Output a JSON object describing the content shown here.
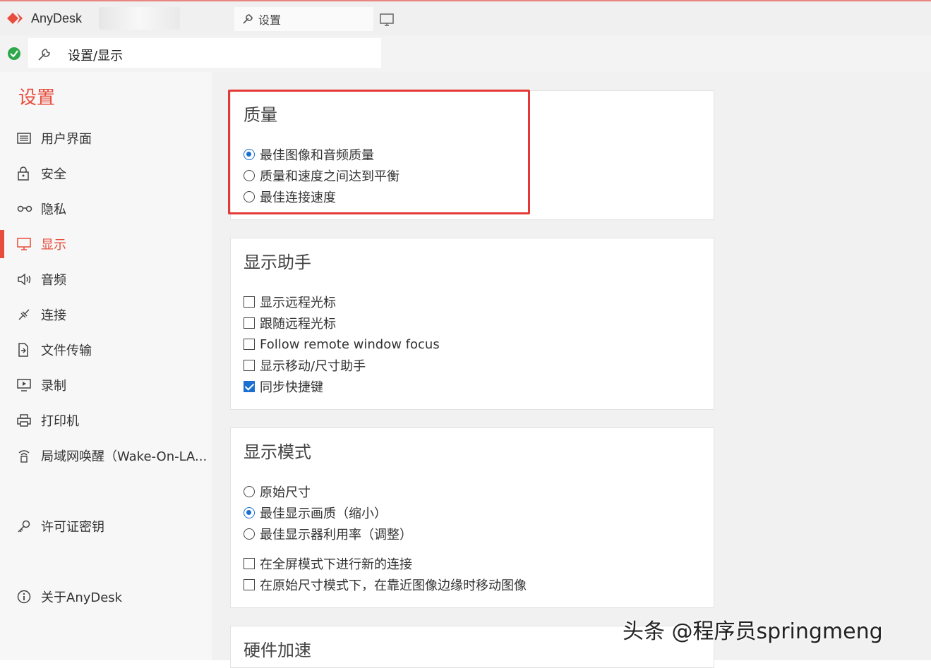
{
  "app": {
    "name": "AnyDesk",
    "brand_color": "#e74c3c",
    "accent_color": "#1a6fd0"
  },
  "tabs": {
    "settings_label": "设置"
  },
  "address": {
    "path": "设置/显示"
  },
  "sidebar": {
    "title": "设置",
    "items": [
      {
        "label": "用户界面",
        "icon": "window-icon",
        "active": false
      },
      {
        "label": "安全",
        "icon": "lock-icon",
        "active": false
      },
      {
        "label": "隐私",
        "icon": "glasses-icon",
        "active": false
      },
      {
        "label": "显示",
        "icon": "monitor-icon",
        "active": true
      },
      {
        "label": "音频",
        "icon": "speaker-icon",
        "active": false
      },
      {
        "label": "连接",
        "icon": "connection-icon",
        "active": false
      },
      {
        "label": "文件传输",
        "icon": "file-transfer-icon",
        "active": false
      },
      {
        "label": "录制",
        "icon": "recording-icon",
        "active": false
      },
      {
        "label": "打印机",
        "icon": "printer-icon",
        "active": false
      },
      {
        "label": "局域网唤醒（Wake-On-LA...",
        "icon": "wake-icon",
        "active": false
      },
      {
        "label": "许可证密钥",
        "icon": "key-icon",
        "active": false
      },
      {
        "label": "关于AnyDesk",
        "icon": "info-icon",
        "active": false
      }
    ]
  },
  "quality": {
    "title": "质量",
    "options": [
      {
        "label": "最佳图像和音频质量",
        "selected": true
      },
      {
        "label": "质量和速度之间达到平衡",
        "selected": false
      },
      {
        "label": "最佳连接速度",
        "selected": false
      }
    ]
  },
  "display_helper": {
    "title": "显示助手",
    "options": [
      {
        "label": "显示远程光标",
        "checked": false
      },
      {
        "label": "跟随远程光标",
        "checked": false
      },
      {
        "label": "Follow remote window focus",
        "checked": false
      },
      {
        "label": "显示移动/尺寸助手",
        "checked": false
      },
      {
        "label": "同步快捷键",
        "checked": true
      }
    ]
  },
  "display_mode": {
    "title": "显示模式",
    "radios": [
      {
        "label": "原始尺寸",
        "selected": false
      },
      {
        "label": "最佳显示画质（缩小）",
        "selected": true
      },
      {
        "label": "最佳显示器利用率（调整）",
        "selected": false
      }
    ],
    "checks": [
      {
        "label": "在全屏模式下进行新的连接",
        "checked": false
      },
      {
        "label": "在原始尺寸模式下，在靠近图像边缘时移动图像",
        "checked": false
      }
    ]
  },
  "hardware": {
    "title": "硬件加速"
  },
  "watermark": "头条 @程序员springmeng"
}
